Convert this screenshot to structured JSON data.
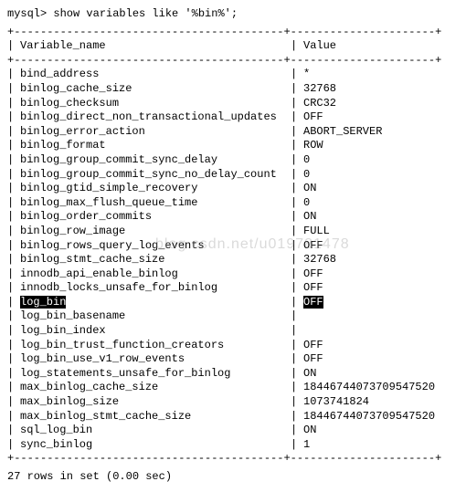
{
  "prompt": "mysql> show variables like '%bin%';",
  "header": {
    "col1": "Variable_name",
    "col2": "Value"
  },
  "rows": [
    {
      "name": "bind_address",
      "value": "*",
      "hl": false
    },
    {
      "name": "binlog_cache_size",
      "value": "32768",
      "hl": false
    },
    {
      "name": "binlog_checksum",
      "value": "CRC32",
      "hl": false
    },
    {
      "name": "binlog_direct_non_transactional_updates",
      "value": "OFF",
      "hl": false
    },
    {
      "name": "binlog_error_action",
      "value": "ABORT_SERVER",
      "hl": false
    },
    {
      "name": "binlog_format",
      "value": "ROW",
      "hl": false
    },
    {
      "name": "binlog_group_commit_sync_delay",
      "value": "0",
      "hl": false
    },
    {
      "name": "binlog_group_commit_sync_no_delay_count",
      "value": "0",
      "hl": false
    },
    {
      "name": "binlog_gtid_simple_recovery",
      "value": "ON",
      "hl": false
    },
    {
      "name": "binlog_max_flush_queue_time",
      "value": "0",
      "hl": false
    },
    {
      "name": "binlog_order_commits",
      "value": "ON",
      "hl": false
    },
    {
      "name": "binlog_row_image",
      "value": "FULL",
      "hl": false
    },
    {
      "name": "binlog_rows_query_log_events",
      "value": "OFF",
      "hl": false
    },
    {
      "name": "binlog_stmt_cache_size",
      "value": "32768",
      "hl": false
    },
    {
      "name": "innodb_api_enable_binlog",
      "value": "OFF",
      "hl": false
    },
    {
      "name": "innodb_locks_unsafe_for_binlog",
      "value": "OFF",
      "hl": false
    },
    {
      "name": "log_bin",
      "value": "OFF",
      "hl": true
    },
    {
      "name": "log_bin_basename",
      "value": "",
      "hl": false
    },
    {
      "name": "log_bin_index",
      "value": "",
      "hl": false
    },
    {
      "name": "log_bin_trust_function_creators",
      "value": "OFF",
      "hl": false
    },
    {
      "name": "log_bin_use_v1_row_events",
      "value": "OFF",
      "hl": false
    },
    {
      "name": "log_statements_unsafe_for_binlog",
      "value": "ON",
      "hl": false
    },
    {
      "name": "max_binlog_cache_size",
      "value": "18446744073709547520",
      "hl": false
    },
    {
      "name": "max_binlog_size",
      "value": "1073741824",
      "hl": false
    },
    {
      "name": "max_binlog_stmt_cache_size",
      "value": "18446744073709547520",
      "hl": false
    },
    {
      "name": "sql_log_bin",
      "value": "ON",
      "hl": false
    },
    {
      "name": "sync_binlog",
      "value": "1",
      "hl": false
    }
  ],
  "footer": "27 rows in set (0.00 sec)",
  "watermark": "blog.csdn.net/u019781478",
  "borders": {
    "top": "+-----------------------------------------+----------------------+",
    "pipe": "|"
  }
}
